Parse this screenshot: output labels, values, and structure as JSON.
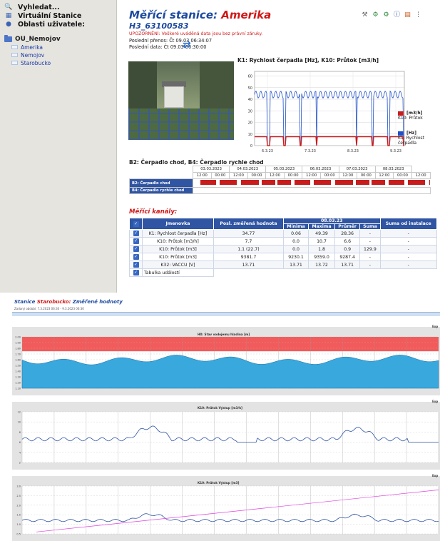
{
  "sidebar": {
    "menu": [
      {
        "label": "Vyhledat...",
        "icon": "search-icon"
      },
      {
        "label": "Virtuální Stanice",
        "icon": "virtual-station-icon"
      },
      {
        "label": "Oblasti uživatele:",
        "icon": "user-icon"
      }
    ],
    "tree_root": "OU_Nemojov",
    "tree_items": [
      "Amerika",
      "Nemojov",
      "Starobucko"
    ]
  },
  "header": {
    "title_prefix": "Měřící stanice:",
    "title_station": "Amerika",
    "code": "H3_63100583",
    "warning": "UPOZORNĚNÍ: Veškeré uváděná data jsou bez právní záruky.",
    "last_transfer_label": "Poslední přenos:",
    "last_transfer_value": "Čt 09.03 06:34:07",
    "last_data_label": "Poslední data:",
    "last_data_value": "Čt 09.03 06:30:00"
  },
  "k_chart": {
    "title": "K1: Rychlost čerpadla [Hz], K10: Průtok [m3/h]",
    "legend": [
      {
        "unit": "[m3/h]",
        "name": "K10: Průtok",
        "color": "#c81d1d"
      },
      {
        "unit": "[Hz]",
        "name": "K1: Rychlost čerpadla",
        "color": "#1f4fc8"
      }
    ]
  },
  "chart_data": {
    "type": "line",
    "title": "K1: Rychlost čerpadla [Hz], K10: Průtok [m3/h]",
    "x_ticks": [
      "6.3.23",
      "7.3.23",
      "8.3.23",
      "9.3.23"
    ],
    "y_ticks": [
      0,
      10,
      20,
      30,
      40,
      50,
      60
    ],
    "ylim": [
      0,
      64
    ],
    "series": [
      {
        "name": "K1: Rychlost čerpadla",
        "unit": "[Hz]",
        "color": "#1f4fc8",
        "on_level": 44,
        "off_level": 0
      },
      {
        "name": "K10: Průtok",
        "unit": "[m3/h]",
        "color": "#c81d1d",
        "on_level": 7.7,
        "off_level": 0
      }
    ],
    "grid": true,
    "legend": "right"
  },
  "pump": {
    "title": "B2: Čerpadlo chod, B4: Čerpadlo rychle chod",
    "dates": [
      "03.03.2023",
      "04.03.2023",
      "05.03.2023",
      "06.03.2023",
      "07.03.2023",
      "08.03.2023"
    ],
    "hours": [
      "12:00",
      "00:00",
      "12:00",
      "00:00",
      "12:00",
      "00:00",
      "12:00",
      "00:00",
      "12:00",
      "00:00",
      "12:00",
      "00:00",
      "12:00"
    ],
    "rows": [
      "B2: Čerpadlo chod",
      "B4: Čerpadlo rychle chod"
    ]
  },
  "channels": {
    "title": "Měřící kanály:",
    "headers": {
      "name": "Jmenovka",
      "last": "Posl. změřená hodnota",
      "date": "08.03.23",
      "min": "Minima",
      "max": "Maxima",
      "avg": "Průměr",
      "sum": "Suma",
      "sum_inst": "Suma od instalace"
    },
    "rows": [
      {
        "name": "K1: Rychlost čerpadla [Hz]",
        "last": "34.77",
        "min": "0.06",
        "max": "49.39",
        "avg": "28.36",
        "sum": "-",
        "inst": "-"
      },
      {
        "name": "K10: Průtok [m3/h]",
        "last": "7.7",
        "min": "0.0",
        "max": "10.7",
        "avg": "6.6",
        "sum": "-",
        "inst": "-"
      },
      {
        "name": "K10: Průtok [m3]",
        "last": "1.1 (22.7)",
        "min": "0.0",
        "max": "1.8",
        "avg": "0.9",
        "sum": "129.9",
        "inst": "-"
      },
      {
        "name": "K10: Průtok [m3]",
        "last": "9381.7",
        "min": "9230.1",
        "max": "9359.0",
        "avg": "9287.4",
        "sum": "-",
        "inst": "-"
      },
      {
        "name": "K32: VACCU [V]",
        "last": "13.71",
        "min": "13.71",
        "max": "13.72",
        "avg": "13.71",
        "sum": "-",
        "inst": "-"
      }
    ],
    "events": "Tabulka událostí"
  },
  "section2": {
    "prefix": "Stanice",
    "station": "Starobucko:",
    "suffix": "Změřené hodnoty",
    "range_note": "Zadaný období: 7.3.2023 06:30 - 9.3.2023 06:30",
    "export": "Exp"
  },
  "panels": [
    {
      "title": "H0: Stav vodojemu hladina [m]",
      "y_ticks": [
        "2.00",
        "1.90",
        "1.80",
        "1.70",
        "1.60",
        "1.50",
        "1.40",
        "1.30",
        "1.20",
        "1.10"
      ]
    },
    {
      "title": "K10: Průtok Výstup [m3/h]",
      "y_ticks": [
        "12",
        "10",
        "8",
        "6",
        "4",
        "2"
      ]
    },
    {
      "title": "K10: Průtok Výstup [m3]",
      "y_ticks": [
        "3.0",
        "2.5",
        "2.0",
        "1.5",
        "1.0",
        "0.5"
      ]
    }
  ]
}
